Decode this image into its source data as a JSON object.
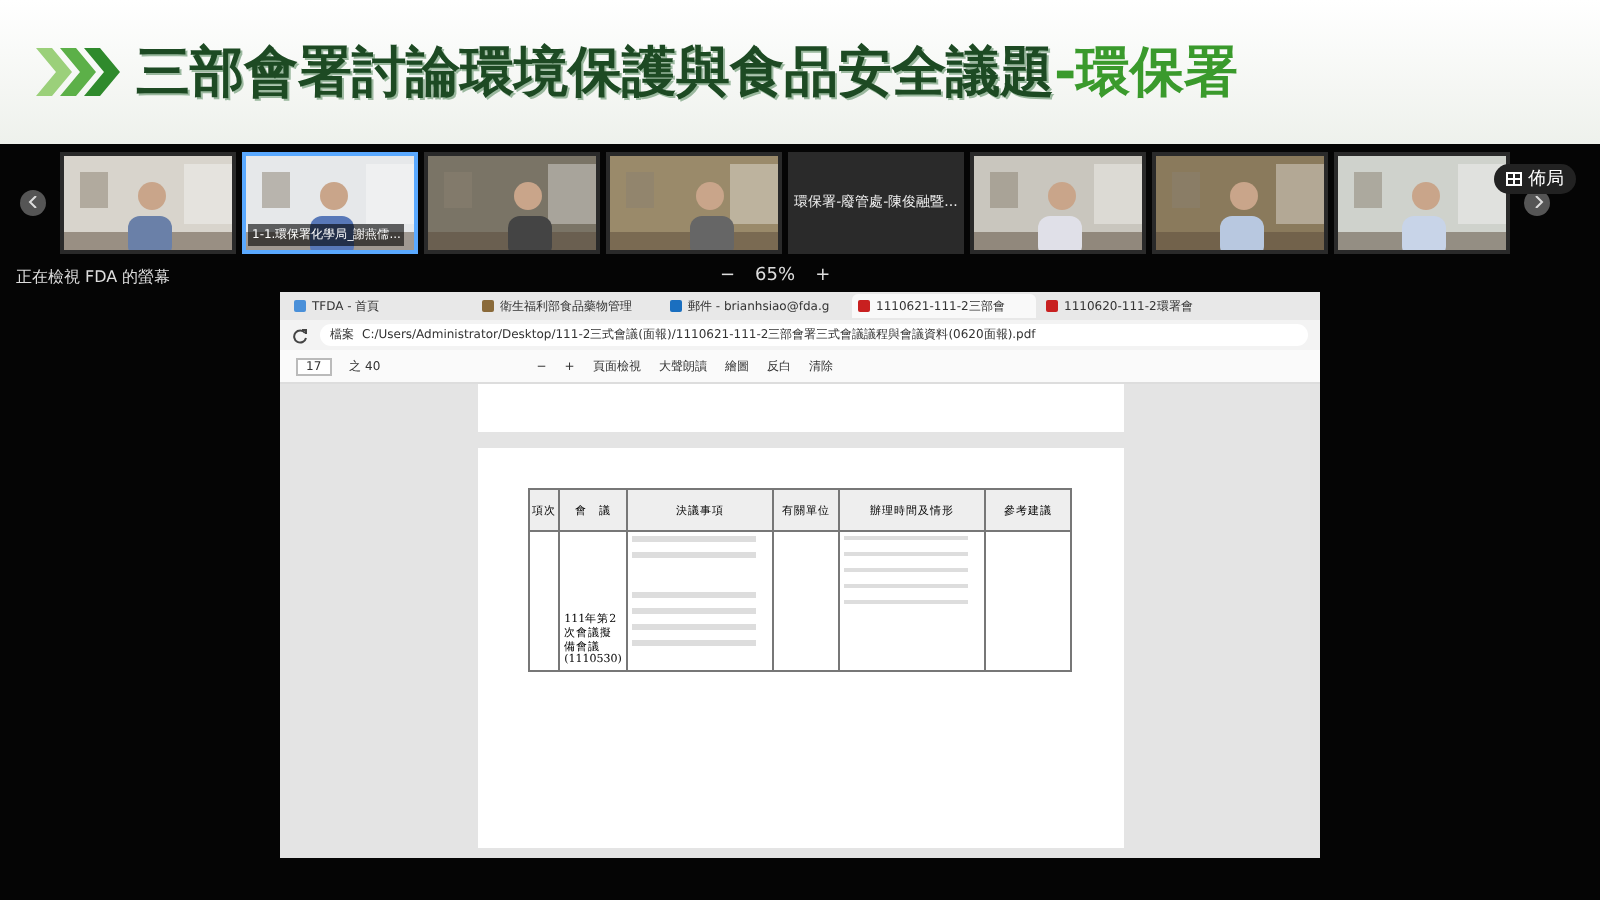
{
  "banner": {
    "title": "三部會署討論環境保護與食品安全議題",
    "suffix": "-環保署"
  },
  "meeting": {
    "tiles": [
      {
        "kind": "video",
        "selected": false
      },
      {
        "kind": "video",
        "caption": "1-1.環保署化學局_謝燕儒...",
        "selected": true
      },
      {
        "kind": "video",
        "selected": false
      },
      {
        "kind": "video",
        "selected": false
      },
      {
        "kind": "name",
        "caption": "環保署-廢管處-陳俊融暨...",
        "selected": false
      },
      {
        "kind": "video",
        "selected": false
      },
      {
        "kind": "video",
        "selected": false
      },
      {
        "kind": "video",
        "selected": false
      }
    ],
    "layout_button": "佈局",
    "sharing_label": "正在檢視 FDA 的螢幕",
    "zoom_out": "−",
    "zoom": "65%",
    "zoom_in": "+"
  },
  "browser": {
    "tabs": [
      {
        "label": "TFDA - 首頁",
        "selected": false
      },
      {
        "label": "衛生福利部食品藥物管理",
        "selected": false
      },
      {
        "label": "郵件 - brianhsiao@fda.g",
        "selected": false
      },
      {
        "label": "1110621-111-2三部會",
        "selected": true
      },
      {
        "label": "1110620-111-2環署會",
        "selected": false
      }
    ],
    "address_label": "檔案",
    "address": "C:/Users/Administrator/Desktop/111-2三式會議(面報)/1110621-111-2三部會署三式會議議程與會議資料(0620面報).pdf",
    "page": "17",
    "page_total": "之 40",
    "zoom_out": "−",
    "zoom_in": "+",
    "tools": [
      "頁面檢視",
      "大聲朗讀",
      "繪圖",
      "反白",
      "清除"
    ]
  },
  "table": {
    "columns": [
      "項次",
      "會　議",
      "決議事項",
      "有關單位",
      "辦理時間及情形",
      "參考建議"
    ],
    "rows": [
      {
        "meeting": "111年第2次會議擬備會議(1110530)"
      }
    ]
  }
}
